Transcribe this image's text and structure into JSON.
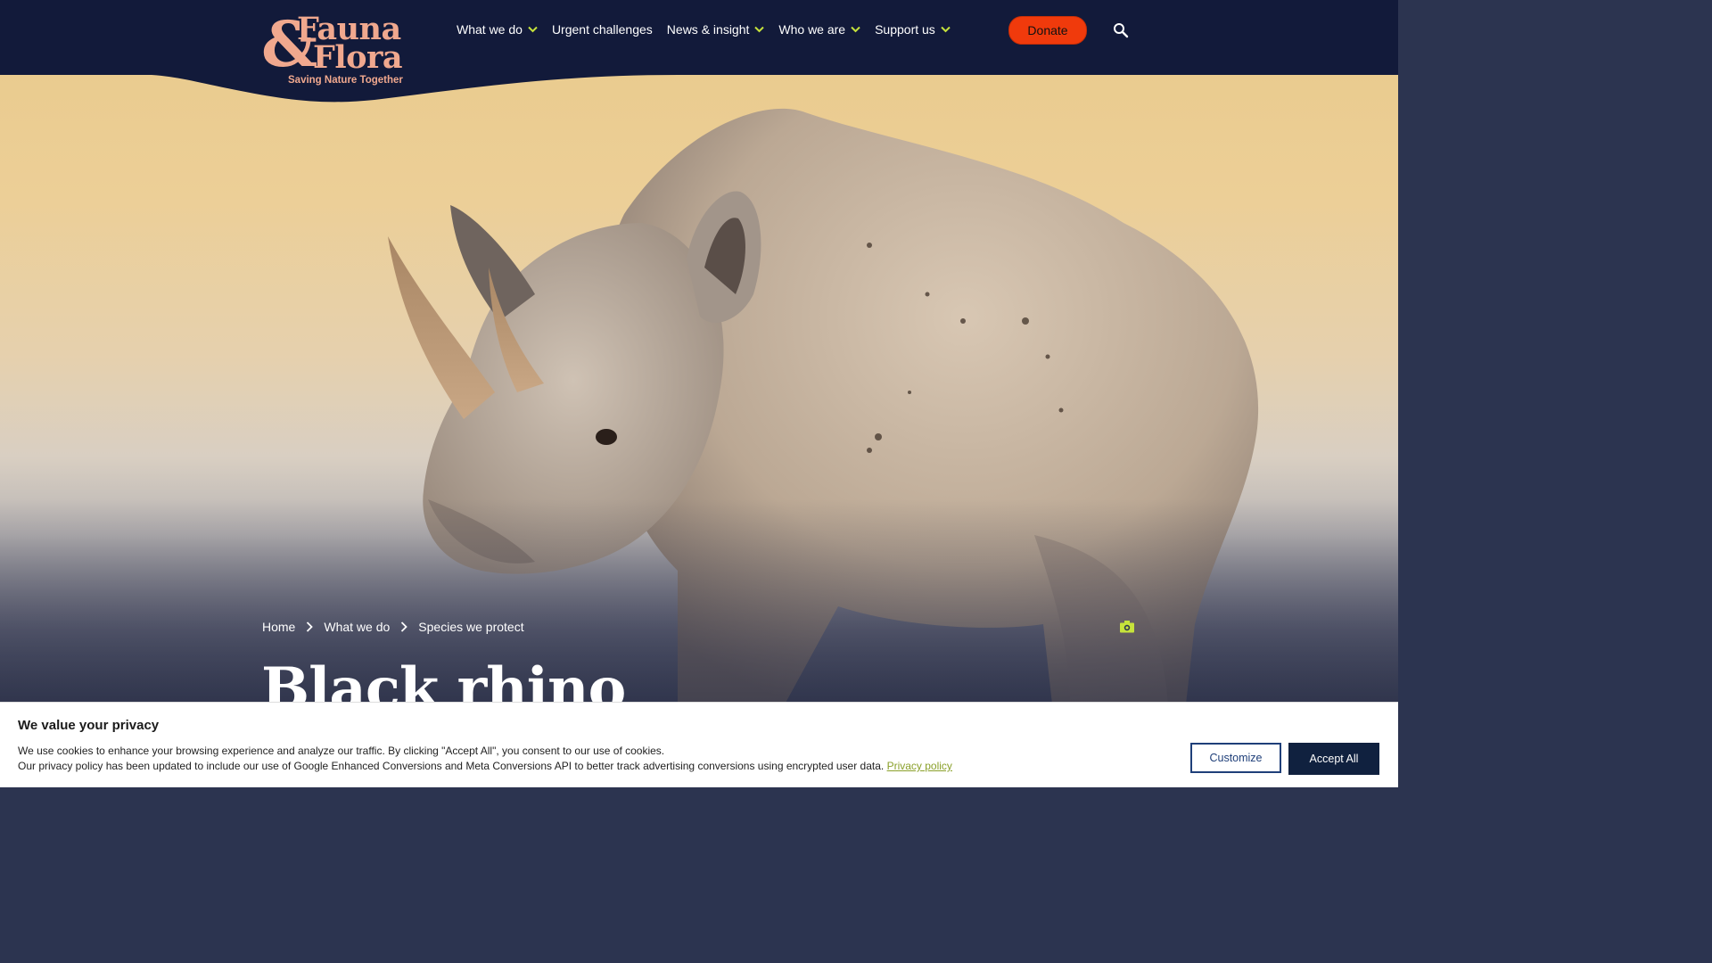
{
  "brand": {
    "logo_line1": "Fauna",
    "logo_line2": "Flora",
    "logo_amp": "&",
    "tagline": "Saving Nature Together",
    "colors": {
      "navy": "#121a3a",
      "salmon": "#f0a88e",
      "donate": "#f03a0c",
      "accent": "#c6e33b"
    }
  },
  "nav": {
    "items": [
      {
        "label": "What we do",
        "has_dropdown": true
      },
      {
        "label": "Urgent challenges",
        "has_dropdown": false
      },
      {
        "label": "News & insight",
        "has_dropdown": true
      },
      {
        "label": "Who we are",
        "has_dropdown": true
      },
      {
        "label": "Support us",
        "has_dropdown": true
      }
    ],
    "donate_label": "Donate",
    "search_icon": "search-icon"
  },
  "breadcrumb": [
    "Home",
    "What we do",
    "Species we protect"
  ],
  "page": {
    "title": "Black rhino",
    "photo_icon": "camera-icon"
  },
  "cookie": {
    "title": "We value your privacy",
    "line1": "We use cookies to enhance your browsing experience and analyze our traffic. By clicking \"Accept All\", you consent to our use of cookies.",
    "line2": "Our privacy policy has been updated to include our use of Google Enhanced Conversions and Meta Conversions API to better track advertising conversions using encrypted user data.",
    "link": "Privacy policy",
    "customize_label": "Customize",
    "accept_label": "Accept All"
  }
}
